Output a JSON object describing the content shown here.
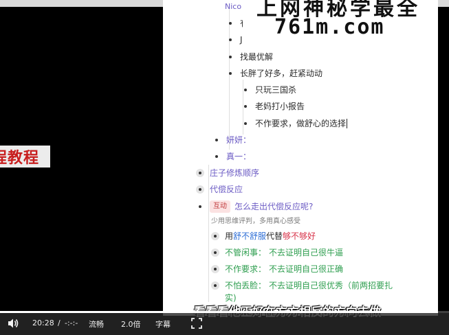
{
  "doc": {
    "top_fragment": "Nico",
    "cut_item_1": "有",
    "cut_item_2": "J",
    "items_level2": [
      "找最优解",
      "长胖了好多，赶紧动动"
    ],
    "items_level3": [
      "只玩三国杀",
      "老妈打小报告",
      "不作要求，做舒心的选择"
    ],
    "sub_purple_1": "妍妍：",
    "sub_purple_2": "真一：",
    "top_items": [
      "庄子修炼顺序",
      "代偿反应"
    ],
    "interaction_tag": "互动",
    "interaction_question": "怎么走出代偿反应呢?",
    "note": "少用思维评判，多用真心感受",
    "use_prefix": "用",
    "use_blue": "舒不舒服",
    "use_mid": "代替",
    "use_red": "够不够好",
    "green_items": [
      {
        "label": "不管闲事：",
        "text": "不去证明自己很牛逼"
      },
      {
        "label": "不作要求：",
        "text": "不去证明自己很正确"
      },
      {
        "label": "不怕丢脸：",
        "text": "不去证明自己很优秀（前两招要扎"
      }
    ],
    "cut_bottom": "实)",
    "bottom_cut_item": "案例讲解"
  },
  "watermark": {
    "top_text": "上网神秘学最全",
    "url": "761m.com"
  },
  "left_banner": "程教程",
  "subtitle": "看看看他正好在方方相反的方向去做",
  "player": {
    "time_current": "20:28",
    "time_separator": "/",
    "time_total": "-:-:-",
    "quality": "流畅",
    "speed": "2.0倍",
    "captions": "字幕",
    "progress": 0.96,
    "icons": [
      "volume-icon",
      "fullscreen-icon"
    ]
  }
}
